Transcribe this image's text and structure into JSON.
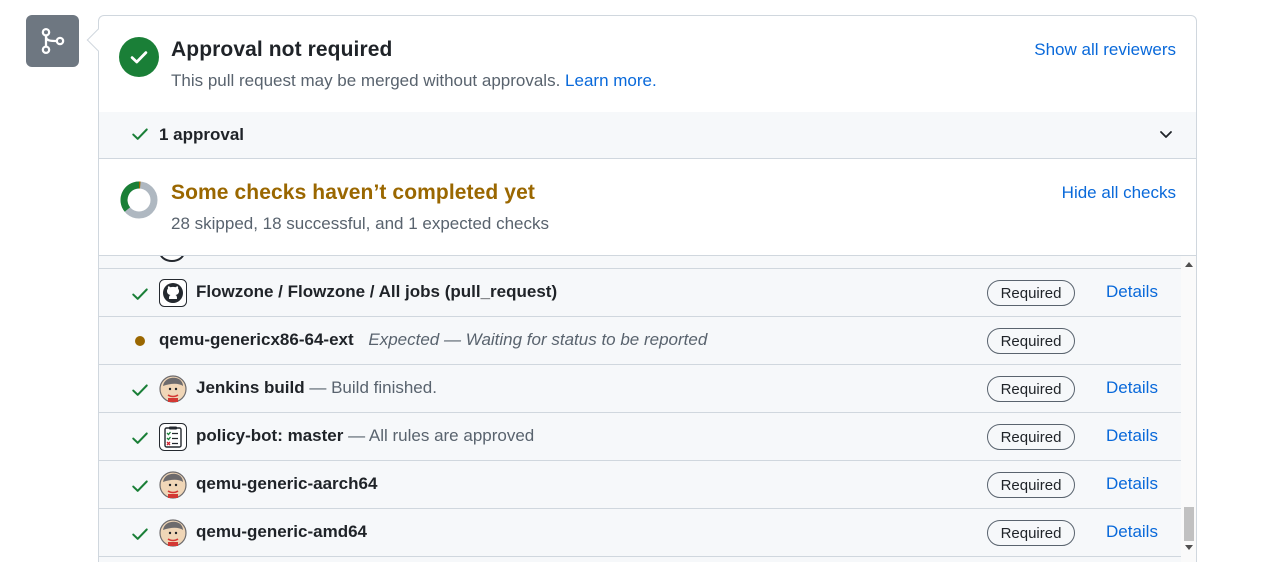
{
  "merge_icon": "git-merge-icon",
  "approval": {
    "title": "Approval not required",
    "subtitle": "This pull request may be merged without approvals.",
    "learn_more": "Learn more.",
    "show_reviewers": "Show all reviewers",
    "approvals_label": "1 approval"
  },
  "checks": {
    "title": "Some checks haven’t completed yet",
    "summary": "28 skipped, 18 successful, and 1 expected checks",
    "hide_link": "Hide all checks",
    "rows": [
      {
        "status": "success",
        "avatar": "github-icon",
        "name": "Flowzone / Flowzone / All jobs (pull_request)",
        "desc": "",
        "badge": "Required",
        "details": "Details"
      },
      {
        "status": "expected",
        "avatar": "",
        "name": "qemu-genericx86-64-ext",
        "desc": "Expected — Waiting for status to be reported",
        "badge": "Required",
        "details": ""
      },
      {
        "status": "success",
        "avatar": "jenkins-icon",
        "name": "Jenkins build",
        "desc": "— Build finished.",
        "badge": "Required",
        "details": "Details"
      },
      {
        "status": "success",
        "avatar": "policy-bot-icon",
        "name": "policy-bot: master",
        "desc": "— All rules are approved",
        "badge": "Required",
        "details": "Details"
      },
      {
        "status": "success",
        "avatar": "jenkins-icon",
        "name": "qemu-generic-aarch64",
        "desc": "",
        "badge": "Required",
        "details": "Details"
      },
      {
        "status": "success",
        "avatar": "jenkins-icon",
        "name": "qemu-generic-amd64",
        "desc": "",
        "badge": "Required",
        "details": "Details"
      }
    ]
  },
  "colors": {
    "success": "#1a7f37",
    "pending": "#9a6700",
    "link": "#0969da",
    "muted": "#59636e"
  }
}
